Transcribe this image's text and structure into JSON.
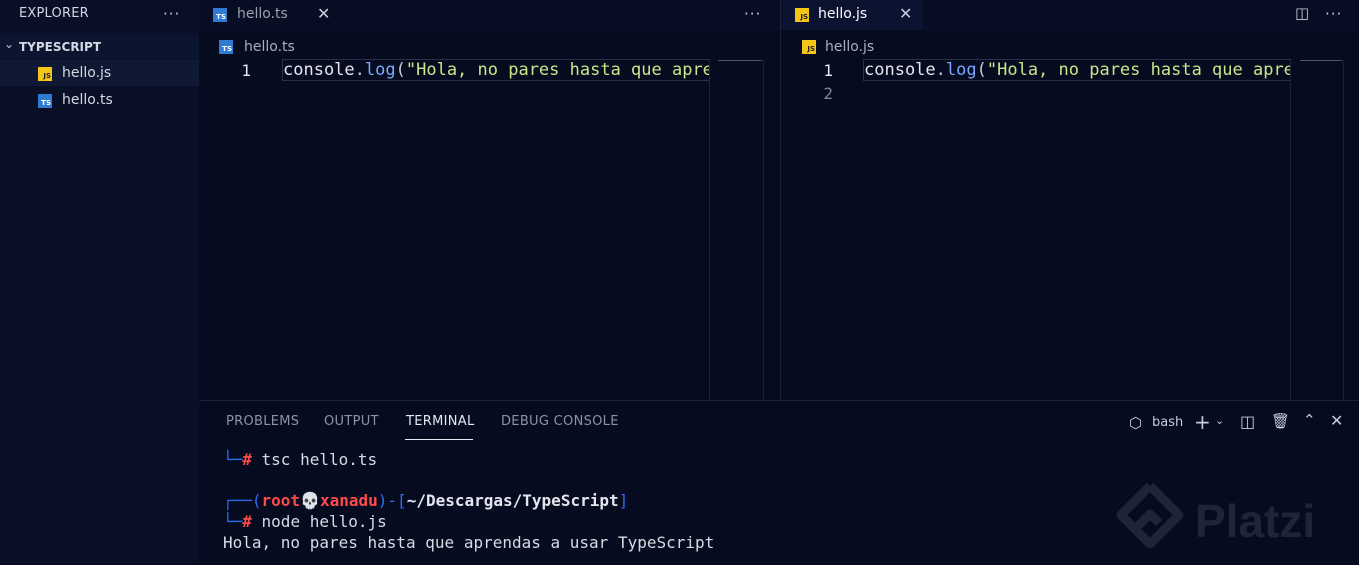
{
  "sidebar": {
    "title": "EXPLORER",
    "folder": "TYPESCRIPT",
    "files": [
      {
        "name": "hello.js",
        "type": "js",
        "active": true
      },
      {
        "name": "hello.ts",
        "type": "ts",
        "active": false
      }
    ]
  },
  "editors": [
    {
      "tab_label": "hello.ts",
      "tab_icon": "ts",
      "breadcrumb": "hello.ts",
      "lines": [
        {
          "number": "1",
          "tokens": [
            {
              "text": "console",
              "type": "obj"
            },
            {
              "text": ".",
              "type": "punc"
            },
            {
              "text": "log",
              "type": "fn"
            },
            {
              "text": "(",
              "type": "punc"
            },
            {
              "text": "\"Hola, no pares hasta que apren",
              "type": "str"
            }
          ]
        }
      ]
    },
    {
      "tab_label": "hello.js",
      "tab_icon": "js",
      "breadcrumb": "hello.js",
      "lines": [
        {
          "number": "1",
          "tokens": [
            {
              "text": "console",
              "type": "obj"
            },
            {
              "text": ".",
              "type": "punc"
            },
            {
              "text": "log",
              "type": "fn"
            },
            {
              "text": "(",
              "type": "punc"
            },
            {
              "text": "\"Hola, no pares hasta que apren",
              "type": "str"
            }
          ]
        },
        {
          "number": "2",
          "tokens": []
        }
      ]
    }
  ],
  "icon_labels": {
    "ts": "TS",
    "js": "JS"
  },
  "panel": {
    "tabs": [
      "PROBLEMS",
      "OUTPUT",
      "TERMINAL",
      "DEBUG CONSOLE"
    ],
    "active_tab": "TERMINAL",
    "shell": "bash"
  },
  "terminal": {
    "line1_prompt": "└─",
    "line1_hash": "#",
    "line1_cmd": " tsc hello.ts",
    "line2_prefix": "┌──(",
    "line2_user": "root",
    "line2_skull": "💀",
    "line2_host": "xanadu",
    "line2_mid": ")-[",
    "line2_path": "~/Descargas/TypeScript",
    "line2_end": "]",
    "line3_prompt": "└─",
    "line3_hash": "#",
    "line3_cmd": " node hello.js",
    "output": "Hola, no pares hasta que aprendas a usar TypeScript"
  },
  "watermark": "Platzi",
  "colors": {
    "background": "#060b1f",
    "string": "#c6e88a",
    "function": "#7aa8ff",
    "prompt_blue": "#2f6df0",
    "prompt_red": "#ff4a4a",
    "js_icon": "#f5c518",
    "ts_icon": "#2f7bd3"
  }
}
